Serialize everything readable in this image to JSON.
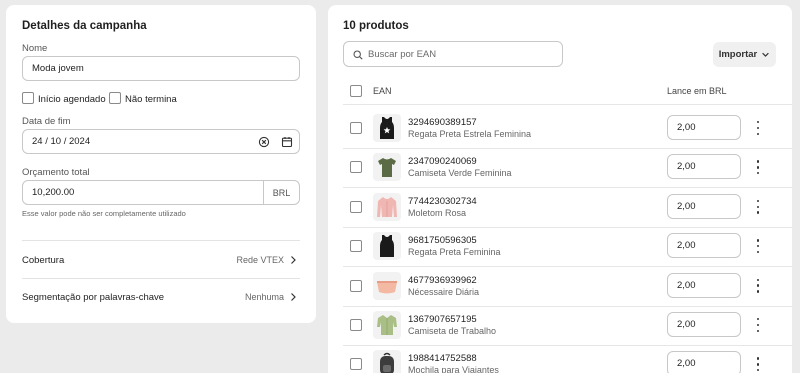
{
  "campaign": {
    "title": "Detalhes da campanha",
    "name_label": "Nome",
    "name_value": "Moda jovem",
    "start_scheduled_label": "Início agendado",
    "no_end_label": "Não termina",
    "end_date_label": "Data de fim",
    "end_date_value": "24 / 10 / 2024",
    "budget_label": "Orçamento total",
    "budget_value": "10,200.00",
    "budget_currency": "BRL",
    "budget_hint": "Esse valor pode não ser completamente utilizado",
    "coverage_label": "Cobertura",
    "coverage_value": "Rede VTEX",
    "keyword_label": "Segmentação por palavras-chave",
    "keyword_value": "Nenhuma"
  },
  "products": {
    "title": "10 produtos",
    "search_placeholder": "Buscar por EAN",
    "import_label": "Importar",
    "col_ean": "EAN",
    "col_bid": "Lance em BRL",
    "rows": [
      {
        "ean": "3294690389157",
        "name": "Regata Preta Estrela Feminina",
        "bid": "2,00",
        "icon": "black-tank-star"
      },
      {
        "ean": "2347090240069",
        "name": "Camiseta Verde Feminina",
        "bid": "2,00",
        "icon": "green-tshirt"
      },
      {
        "ean": "7744230302734",
        "name": "Moletom Rosa",
        "bid": "2,00",
        "icon": "pink-hoodie"
      },
      {
        "ean": "9681750596305",
        "name": "Regata Preta Feminina",
        "bid": "2,00",
        "icon": "black-tank"
      },
      {
        "ean": "4677936939962",
        "name": "Nécessaire Diária",
        "bid": "2,00",
        "icon": "pouch"
      },
      {
        "ean": "1367907657195",
        "name": "Camiseta de Trabalho",
        "bid": "2,00",
        "icon": "green-shirt"
      },
      {
        "ean": "1988414752588",
        "name": "Mochila para Viajantes",
        "bid": "2,00",
        "icon": "backpack"
      }
    ]
  },
  "colors": {
    "background": "#ebebeb",
    "card": "#ffffff",
    "border": "#c8c8c8"
  }
}
